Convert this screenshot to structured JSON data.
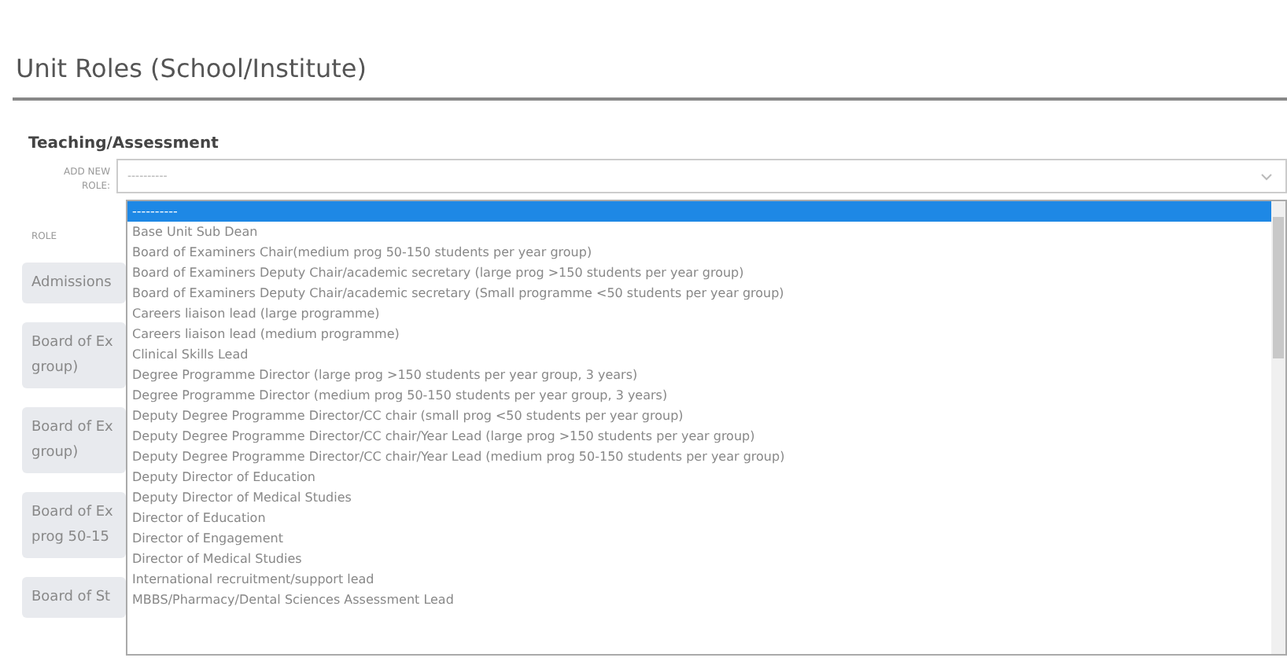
{
  "page_title": "Unit Roles (School/Institute)",
  "section_title": "Teaching/Assessment",
  "add_role": {
    "label": "ADD NEW ROLE:",
    "value": "----------",
    "options": [
      {
        "label": "----------",
        "selected": true
      },
      {
        "label": "Base Unit Sub Dean",
        "selected": false
      },
      {
        "label": "Board of Examiners Chair(medium prog 50-150 students per year group)",
        "selected": false
      },
      {
        "label": "Board of Examiners Deputy Chair/academic secretary (large prog >150 students per year group)",
        "selected": false
      },
      {
        "label": "Board of Examiners Deputy Chair/academic secretary (Small programme <50 students per year group)",
        "selected": false
      },
      {
        "label": "Careers liaison lead (large programme)",
        "selected": false
      },
      {
        "label": "Careers liaison lead (medium programme)",
        "selected": false
      },
      {
        "label": "Clinical Skills Lead",
        "selected": false
      },
      {
        "label": "Degree Programme Director (large prog >150 students per year group, 3 years)",
        "selected": false
      },
      {
        "label": "Degree Programme Director (medium prog 50-150 students per year group, 3 years)",
        "selected": false
      },
      {
        "label": "Deputy Degree Programme Director/CC chair (small prog <50 students per year group)",
        "selected": false
      },
      {
        "label": "Deputy Degree Programme Director/CC chair/Year Lead (large prog >150 students per year group)",
        "selected": false
      },
      {
        "label": "Deputy Degree Programme Director/CC chair/Year Lead (medium prog 50-150 students per year group)",
        "selected": false
      },
      {
        "label": "Deputy Director of Education",
        "selected": false
      },
      {
        "label": "Deputy Director of Medical Studies",
        "selected": false
      },
      {
        "label": "Director of Education",
        "selected": false
      },
      {
        "label": "Director of Engagement",
        "selected": false
      },
      {
        "label": "Director of Medical Studies",
        "selected": false
      },
      {
        "label": "International recruitment/support lead",
        "selected": false
      },
      {
        "label": "MBBS/Pharmacy/Dental Sciences Assessment Lead",
        "selected": false
      }
    ]
  },
  "roles": {
    "header": "ROLE",
    "rows": [
      {
        "lines": [
          "Admissions"
        ]
      },
      {
        "lines": [
          "Board of Ex",
          "group)"
        ]
      },
      {
        "lines": [
          "Board of Ex",
          "group)"
        ]
      },
      {
        "lines": [
          "Board of Ex",
          "prog 50-15"
        ]
      },
      {
        "lines": [
          "Board of St"
        ]
      }
    ]
  }
}
